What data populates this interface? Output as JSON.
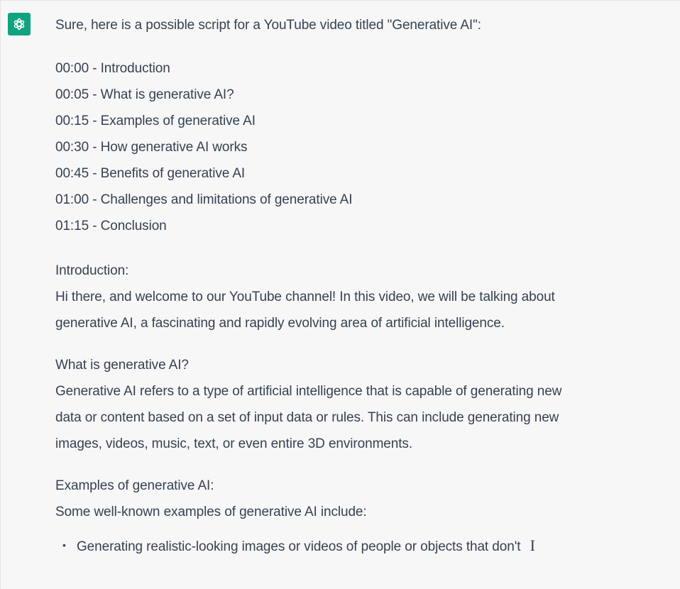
{
  "assistant": {
    "avatar_icon": "openai-logo-icon",
    "avatar_color": "#10a37f"
  },
  "message": {
    "intro": "Sure, here is a possible script for a YouTube video titled \"Generative AI\":",
    "timestamps": [
      "00:00 - Introduction",
      "00:05 - What is generative AI?",
      "00:15 - Examples of generative AI",
      "00:30 - How generative AI works",
      "00:45 - Benefits of generative AI",
      "01:00 - Challenges and limitations of generative AI",
      "01:15 - Conclusion"
    ],
    "sections": [
      {
        "heading": "Introduction:",
        "lines": [
          "Hi there, and welcome to our YouTube channel! In this video, we will be talking about",
          "generative AI, a fascinating and rapidly evolving area of artificial intelligence."
        ]
      },
      {
        "heading": "What is generative AI?",
        "lines": [
          "Generative AI refers to a type of artificial intelligence that is capable of generating new",
          "data or content based on a set of input data or rules. This can include generating new",
          "images, videos, music, text, or even entire 3D environments."
        ]
      },
      {
        "heading": "Examples of generative AI:",
        "lines": [
          "Some well-known examples of generative AI include:"
        ]
      }
    ],
    "bullets": [
      "Generating realistic-looking images or videos of people or objects that don't"
    ],
    "text_cursor": "I"
  }
}
